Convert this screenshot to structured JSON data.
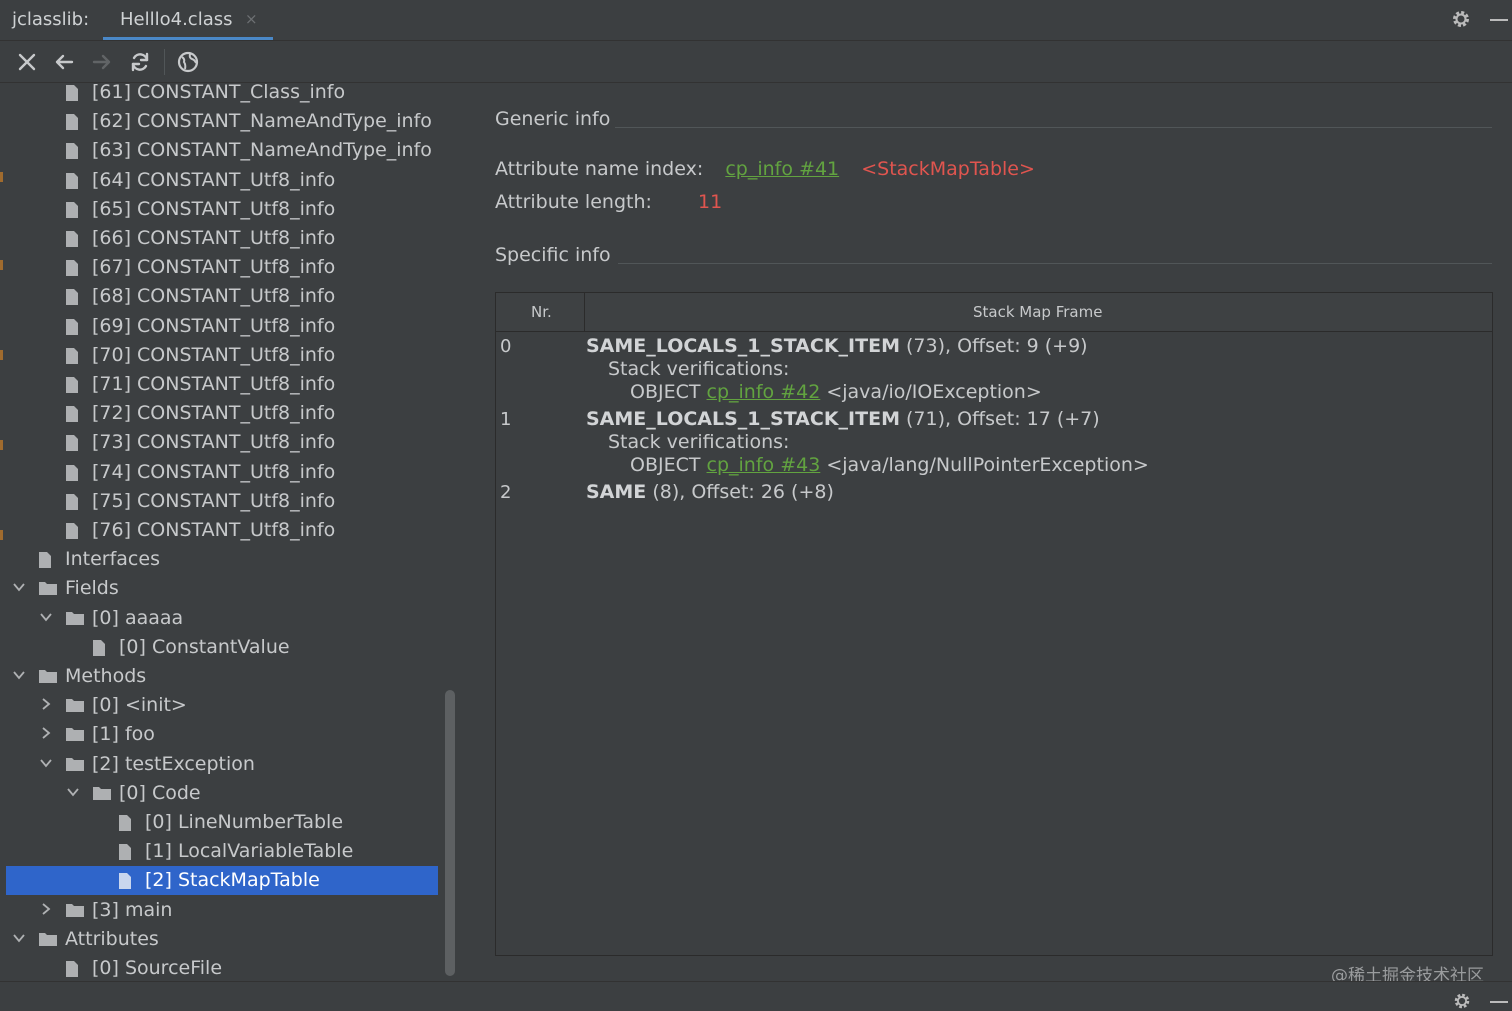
{
  "window": {
    "app_name": "jclasslib:",
    "tab_label": "Helllo4.class",
    "tab_close": "×"
  },
  "icons": {
    "close": "close-icon",
    "back": "arrow-left-icon",
    "forward": "arrow-right-icon",
    "refresh": "refresh-icon",
    "web": "globe-icon",
    "settings": "gear-icon",
    "minimize": "minimize-icon",
    "file": "file-icon",
    "folder": "folder-icon"
  },
  "tree": {
    "items": [
      {
        "label": "[61] CONSTANT_Class_info",
        "level": 2,
        "type": "file"
      },
      {
        "label": "[62] CONSTANT_NameAndType_info",
        "level": 2,
        "type": "file"
      },
      {
        "label": "[63] CONSTANT_NameAndType_info",
        "level": 2,
        "type": "file"
      },
      {
        "label": "[64] CONSTANT_Utf8_info",
        "level": 2,
        "type": "file"
      },
      {
        "label": "[65] CONSTANT_Utf8_info",
        "level": 2,
        "type": "file"
      },
      {
        "label": "[66] CONSTANT_Utf8_info",
        "level": 2,
        "type": "file"
      },
      {
        "label": "[67] CONSTANT_Utf8_info",
        "level": 2,
        "type": "file"
      },
      {
        "label": "[68] CONSTANT_Utf8_info",
        "level": 2,
        "type": "file"
      },
      {
        "label": "[69] CONSTANT_Utf8_info",
        "level": 2,
        "type": "file"
      },
      {
        "label": "[70] CONSTANT_Utf8_info",
        "level": 2,
        "type": "file"
      },
      {
        "label": "[71] CONSTANT_Utf8_info",
        "level": 2,
        "type": "file"
      },
      {
        "label": "[72] CONSTANT_Utf8_info",
        "level": 2,
        "type": "file"
      },
      {
        "label": "[73] CONSTANT_Utf8_info",
        "level": 2,
        "type": "file"
      },
      {
        "label": "[74] CONSTANT_Utf8_info",
        "level": 2,
        "type": "file"
      },
      {
        "label": "[75] CONSTANT_Utf8_info",
        "level": 2,
        "type": "file"
      },
      {
        "label": "[76] CONSTANT_Utf8_info",
        "level": 2,
        "type": "file"
      },
      {
        "label": "Interfaces",
        "level": 1,
        "type": "file"
      },
      {
        "label": "Fields",
        "level": 1,
        "type": "folder",
        "expanded": true
      },
      {
        "label": "[0] aaaaa",
        "level": 2,
        "type": "folder",
        "expanded": true
      },
      {
        "label": "[0] ConstantValue",
        "level": 3,
        "type": "file"
      },
      {
        "label": "Methods",
        "level": 1,
        "type": "folder",
        "expanded": true
      },
      {
        "label": "[0] <init>",
        "level": 2,
        "type": "folder",
        "expanded": false
      },
      {
        "label": "[1] foo",
        "level": 2,
        "type": "folder",
        "expanded": false
      },
      {
        "label": "[2] testException",
        "level": 2,
        "type": "folder",
        "expanded": true
      },
      {
        "label": "[0] Code",
        "level": 3,
        "type": "folder",
        "expanded": true
      },
      {
        "label": "[0] LineNumberTable",
        "level": 4,
        "type": "file"
      },
      {
        "label": "[1] LocalVariableTable",
        "level": 4,
        "type": "file"
      },
      {
        "label": "[2] StackMapTable",
        "level": 4,
        "type": "file",
        "selected": true
      },
      {
        "label": "[3] main",
        "level": 2,
        "type": "folder",
        "expanded": false
      },
      {
        "label": "Attributes",
        "level": 1,
        "type": "folder",
        "expanded": true
      },
      {
        "label": "[0] SourceFile",
        "level": 2,
        "type": "file"
      }
    ]
  },
  "detail": {
    "generic_title": "Generic info",
    "name_index_label": "Attribute name index:",
    "name_index_link": "cp_info #41",
    "name_index_value": "<StackMapTable>",
    "length_label": "Attribute length:",
    "length_value": "11",
    "specific_title": "Specific info"
  },
  "table": {
    "headers": [
      "Nr.",
      "Stack Map Frame"
    ],
    "rows": [
      {
        "nr": "0",
        "frame_type": "SAME_LOCALS_1_STACK_ITEM",
        "frame_rest": " (73), Offset: 9 (+9)",
        "verif_label": "Stack verifications:",
        "obj_prefix": "OBJECT ",
        "obj_link": "cp_info #42",
        "obj_class": " <java/io/IOException>"
      },
      {
        "nr": "1",
        "frame_type": "SAME_LOCALS_1_STACK_ITEM",
        "frame_rest": " (71), Offset: 17 (+7)",
        "verif_label": "Stack verifications:",
        "obj_prefix": "OBJECT ",
        "obj_link": "cp_info #43",
        "obj_class": " <java/lang/NullPointerException>"
      },
      {
        "nr": "2",
        "frame_type": "SAME",
        "frame_rest": " (8), Offset: 26 (+8)"
      }
    ]
  },
  "watermark": "@稀土掘金技术社区",
  "colors": {
    "background": "#3c3f41",
    "selection": "#2f65ca",
    "link": "#62a340",
    "value": "#e0554f",
    "tab_underline": "#4a88c7"
  }
}
